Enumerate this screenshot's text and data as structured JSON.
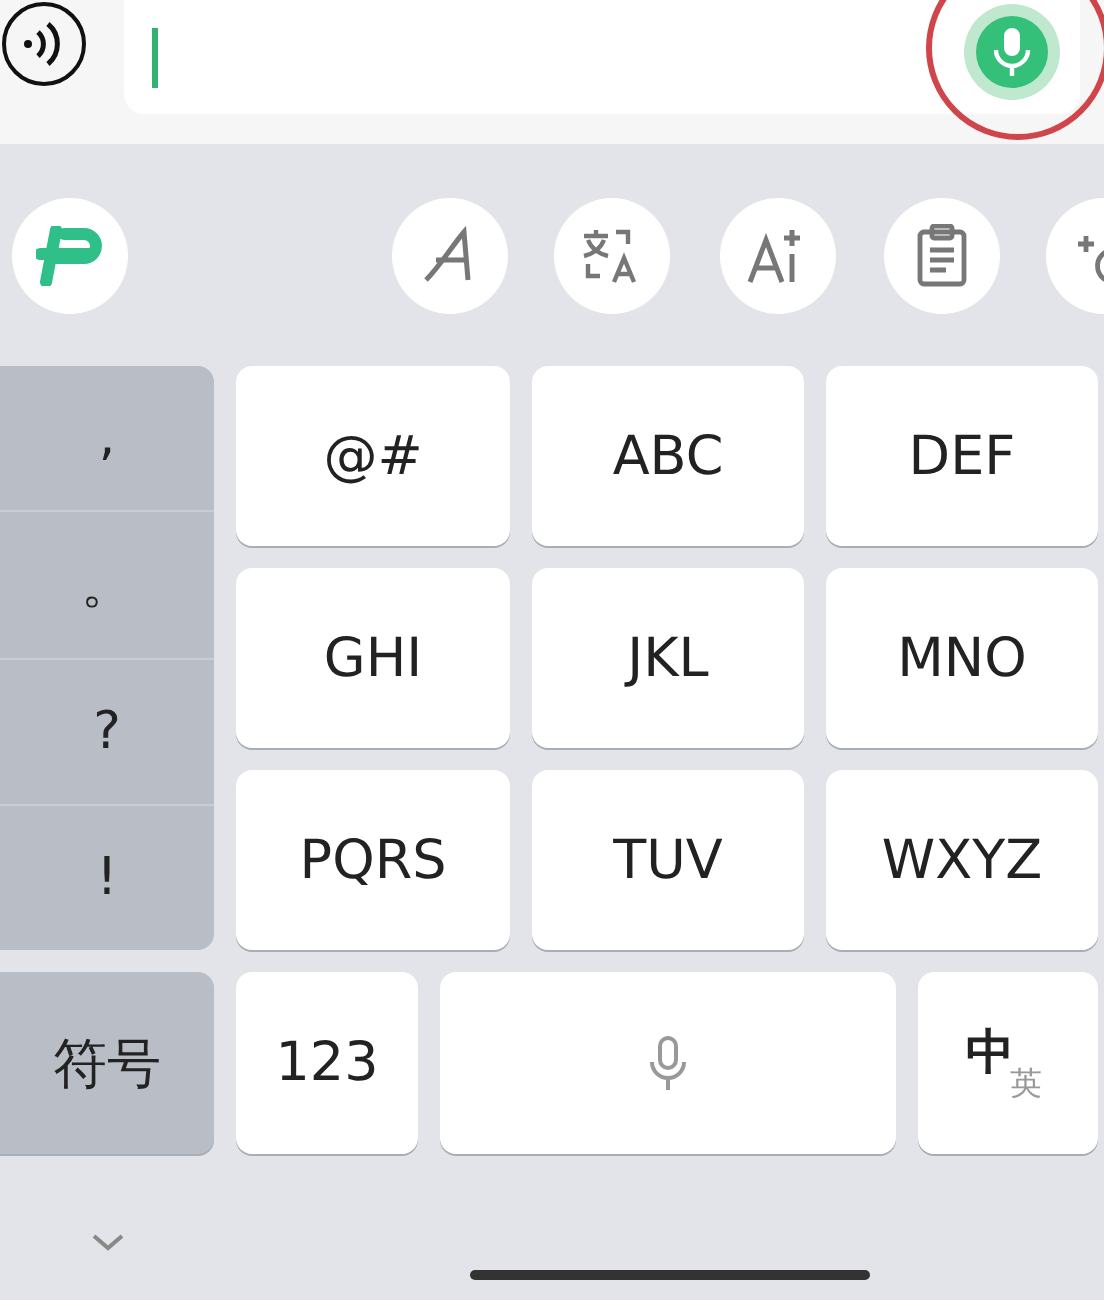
{
  "input_bar": {
    "voice_active": true,
    "highlighted": true
  },
  "toolbar": [
    {
      "kind": "logo"
    },
    {
      "kind": "handwriting"
    },
    {
      "kind": "translate"
    },
    {
      "kind": "ai"
    },
    {
      "kind": "clipboard"
    },
    {
      "kind": "sparkle"
    }
  ],
  "punctuation": [
    ",",
    "。",
    "?",
    "!"
  ],
  "symbols_key": "符号",
  "keys": [
    {
      "label": "@#"
    },
    {
      "label": "ABC"
    },
    {
      "label": "DEF"
    },
    {
      "label": "GHI"
    },
    {
      "label": "JKL"
    },
    {
      "label": "MNO"
    },
    {
      "label": "PQRS"
    },
    {
      "label": "TUV"
    },
    {
      "label": "WXYZ"
    }
  ],
  "bottom_row": {
    "numbers_key": "123",
    "lang_key": {
      "primary": "中",
      "secondary": "英"
    }
  }
}
